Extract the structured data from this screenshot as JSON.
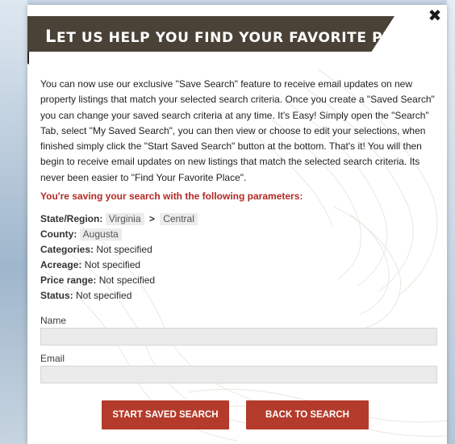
{
  "modal": {
    "title_first": "L",
    "title_rest": "ET US HELP YOU FIND YOUR FAVORITE PLACE",
    "close_symbol": "✖",
    "intro_text": "You can now use our exclusive \"Save Search\" feature to receive email updates on new property listings that match your selected search criteria.  Once you create a \"Saved Search\" you can change your saved search criteria at any time.  It's Easy!  Simply open the \"Search\" Tab, select \"My Saved Search\", you can then view or choose to edit your selections, when finished simply click the \"Start Saved Search\" button at the bottom. That's it! You will then begin to receive email updates on new listings that match the selected search criteria.  Its never been easier to \"Find Your Favorite Place\".",
    "saving_heading": "You're saving your search with the following parameters:"
  },
  "params": {
    "state_label": "State/Region:",
    "state_value": "Virginia",
    "region_separator": ">",
    "region_value": "Central",
    "county_label": "County:",
    "county_value": "Augusta",
    "categories_label": "Categories:",
    "categories_value": "Not specified",
    "acreage_label": "Acreage:",
    "acreage_value": "Not specified",
    "price_label": "Price range:",
    "price_value": "Not specified",
    "status_label": "Status:",
    "status_value": "Not specified"
  },
  "form": {
    "name_label": "Name",
    "name_value": "",
    "email_label": "Email",
    "email_value": ""
  },
  "buttons": {
    "start_label": "START SAVED SEARCH",
    "back_label": "BACK TO SEARCH"
  },
  "colors": {
    "banner": "#4a4236",
    "accent_red": "#b43b2b",
    "heading_red": "#b22a24"
  }
}
